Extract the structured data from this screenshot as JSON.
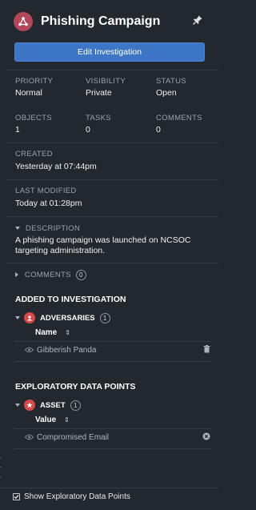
{
  "header": {
    "title": "Phishing Campaign",
    "logo_icon": "share-nodes-icon",
    "pin_icon": "pin-icon",
    "edit_button_label": "Edit Investigation"
  },
  "details": {
    "priority_label": "PRIORITY",
    "priority_value": "Normal",
    "visibility_label": "VISIBILITY",
    "visibility_value": "Private",
    "status_label": "STATUS",
    "status_value": "Open",
    "objects_label": "OBJECTS",
    "objects_value": "1",
    "tasks_label": "TASKS",
    "tasks_value": "0",
    "comments_label": "COMMENTS",
    "comments_value": "0",
    "created_label": "CREATED",
    "created_value": "Yesterday at 07:44pm",
    "modified_label": "LAST MODIFIED",
    "modified_value": "Today at 01:28pm"
  },
  "description": {
    "label": "DESCRIPTION",
    "text_line1": "A phishing campaign was launched on NCSOC",
    "text_line2": "targeting administration."
  },
  "comments_section": {
    "label": "COMMENTS",
    "count": "0"
  },
  "added": {
    "title": "ADDED TO INVESTIGATION",
    "group_label": "ADVERSARIES",
    "group_count": "1",
    "group_icon": "adversary-icon",
    "column_header": "Name",
    "rows": [
      "Gibberish Panda"
    ]
  },
  "exploratory": {
    "title": "EXPLORATORY DATA POINTS",
    "group_label": "ASSET",
    "group_count": "1",
    "group_icon": "asset-icon",
    "column_header": "Value",
    "rows": [
      "Compromised Email"
    ]
  },
  "footer": {
    "checkbox_label": "Show Exploratory Data Points",
    "checked": true
  },
  "colors": {
    "background": "#22282e",
    "accent_button": "#3d76c4",
    "logo": "#b2475a",
    "group_icon": "#d84a4a"
  }
}
